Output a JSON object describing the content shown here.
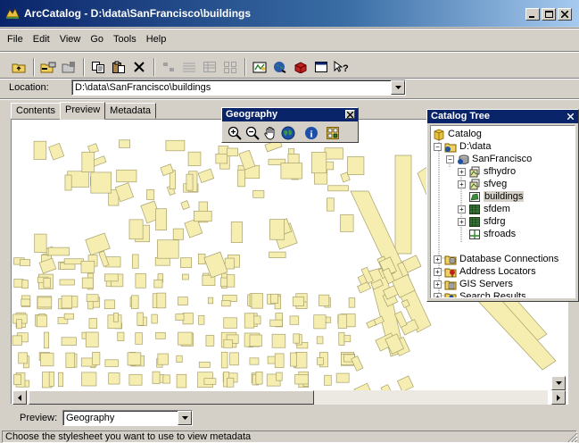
{
  "window": {
    "title": "ArcCatalog - D:\\data\\SanFrancisco\\buildings"
  },
  "menu": [
    "File",
    "Edit",
    "View",
    "Go",
    "Tools",
    "Help"
  ],
  "location": {
    "label": "Location:",
    "value": "D:\\data\\SanFrancisco\\buildings"
  },
  "tabs": [
    "Contents",
    "Preview",
    "Metadata"
  ],
  "active_tab": "Preview",
  "preview": {
    "label": "Preview:",
    "value": "Geography"
  },
  "status": "Choose the stylesheet you want to use to view metadata",
  "geography_toolbar": {
    "title": "Geography",
    "tools": [
      "zoom-in-icon",
      "zoom-out-icon",
      "pan-hand-icon",
      "full-extent-globe-icon",
      "identify-icon",
      "create-thumbnail-icon"
    ]
  },
  "catalog_tree": {
    "title": "Catalog Tree",
    "nodes": [
      {
        "label": "Catalog"
      },
      {
        "label": "D:\\data"
      },
      {
        "label": "SanFrancisco"
      },
      {
        "label": "sfhydro"
      },
      {
        "label": "sfveg"
      },
      {
        "label": "buildings",
        "selected": true
      },
      {
        "label": "sfdem"
      },
      {
        "label": "sfdrg"
      },
      {
        "label": "sfroads"
      },
      {
        "label": "Database Connections"
      },
      {
        "label": "Address Locators"
      },
      {
        "label": "GIS Servers"
      },
      {
        "label": "Search Results"
      }
    ]
  },
  "colors": {
    "title_active": "#0a246a",
    "map_fill": "#f5eeb0",
    "map_stroke": "#a8a06a",
    "face": "#d4d0c8"
  }
}
